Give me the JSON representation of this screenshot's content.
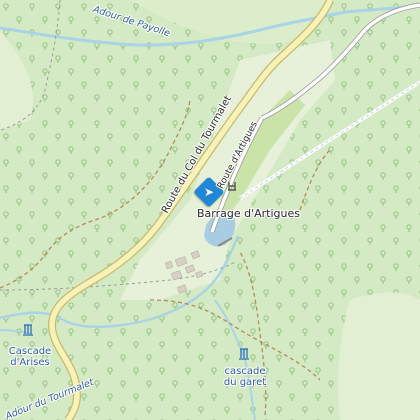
{
  "map": {
    "places": {
      "barrage": "Barrage d'Artigues",
      "cascade_arises": "Cascade\nd'Arises",
      "cascade_garet": "cascade\ndu garet"
    },
    "roads": {
      "col_tourmalet": "Route du Col du Tourmalet",
      "artigues": "Route d'Artigues"
    },
    "waterways": {
      "payolle": "Adour de Payolle",
      "tourmalet": "Adour du Tourmalet"
    },
    "icons": {
      "selected_marker": "direction-pin-icon",
      "cascade": "waterfall-icon",
      "dam": "dam-icon"
    },
    "colors": {
      "forest": "#d4eac4",
      "meadow": "#e6f0d8",
      "road_fill": "#f6f2b8",
      "road_casing": "#c9b96d",
      "river": "#a9d3e6",
      "lake": "#a8cde3",
      "marker": "#1f87d6"
    }
  }
}
